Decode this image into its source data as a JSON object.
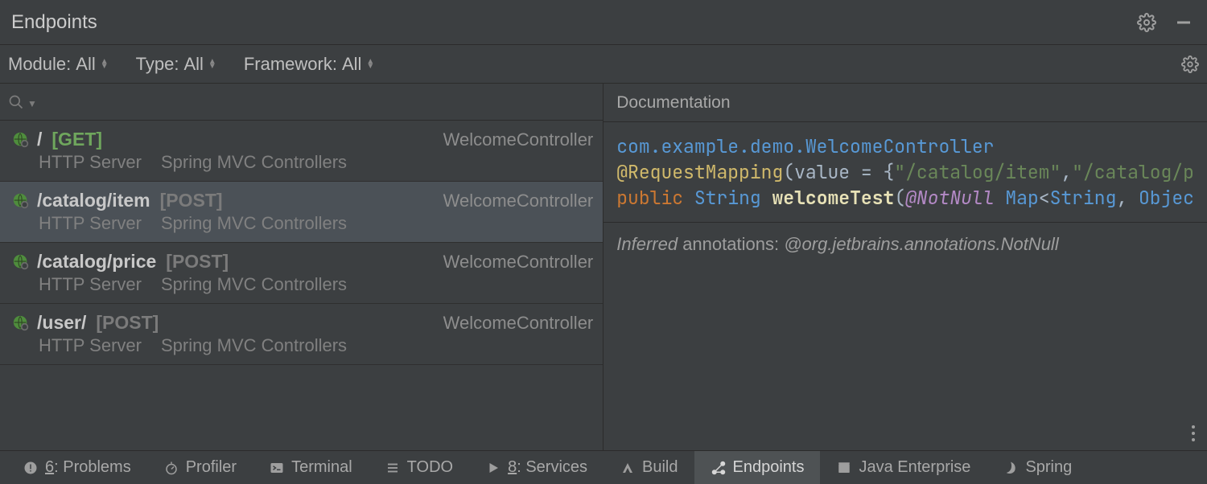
{
  "header": {
    "title": "Endpoints"
  },
  "filters": {
    "module": {
      "label": "Module:",
      "value": "All"
    },
    "type": {
      "label": "Type:",
      "value": "All"
    },
    "framework": {
      "label": "Framework:",
      "value": "All"
    }
  },
  "search": {
    "value": ""
  },
  "endpoints": [
    {
      "path": "/",
      "method": "[GET]",
      "method_color": "#6fa65d",
      "controller": "WelcomeController",
      "server": "HTTP Server",
      "framework": "Spring MVC Controllers",
      "selected": false
    },
    {
      "path": "/catalog/item",
      "method": "[POST]",
      "method_color": "#7b7b7b",
      "controller": "WelcomeController",
      "server": "HTTP Server",
      "framework": "Spring MVC Controllers",
      "selected": true
    },
    {
      "path": "/catalog/price",
      "method": "[POST]",
      "method_color": "#7b7b7b",
      "controller": "WelcomeController",
      "server": "HTTP Server",
      "framework": "Spring MVC Controllers",
      "selected": false
    },
    {
      "path": "/user/",
      "method": "[POST]",
      "method_color": "#7b7b7b",
      "controller": "WelcomeController",
      "server": "HTTP Server",
      "framework": "Spring MVC Controllers",
      "selected": false
    }
  ],
  "documentation": {
    "tab_label": "Documentation",
    "class_link": "com.example.demo.WelcomeController",
    "annotation": "@RequestMapping",
    "annotation_args_prefix": "(value = {",
    "str1": "\"/catalog/item\"",
    "comma": ",",
    "str2": "\"/catalog/p",
    "sig_public": "public",
    "sig_ret": "String",
    "sig_name": "welcomeTest",
    "sig_open": "(",
    "sig_notnull": "@NotNull",
    "sig_map": "Map",
    "sig_lt": "<",
    "sig_string": "String",
    "sig_comma2": ", ",
    "sig_obj": "Objec",
    "inferred_label": "Inferred",
    "inferred_rest": " annotations: ",
    "inferred_anno": "@org.jetbrains.annotations.NotNull"
  },
  "toolbar": [
    {
      "name": "problems",
      "label": "Problems",
      "mnemonic": "6",
      "active": false
    },
    {
      "name": "profiler",
      "label": "Profiler",
      "mnemonic": "",
      "active": false
    },
    {
      "name": "terminal",
      "label": "Terminal",
      "mnemonic": "",
      "active": false
    },
    {
      "name": "todo",
      "label": "TODO",
      "mnemonic": "",
      "active": false
    },
    {
      "name": "services",
      "label": "Services",
      "mnemonic": "8",
      "active": false
    },
    {
      "name": "build",
      "label": "Build",
      "mnemonic": "",
      "active": false
    },
    {
      "name": "endpoints",
      "label": "Endpoints",
      "mnemonic": "",
      "active": true
    },
    {
      "name": "javaenterprise",
      "label": "Java Enterprise",
      "mnemonic": "",
      "active": false
    },
    {
      "name": "spring",
      "label": "Spring",
      "mnemonic": "",
      "active": false
    }
  ]
}
